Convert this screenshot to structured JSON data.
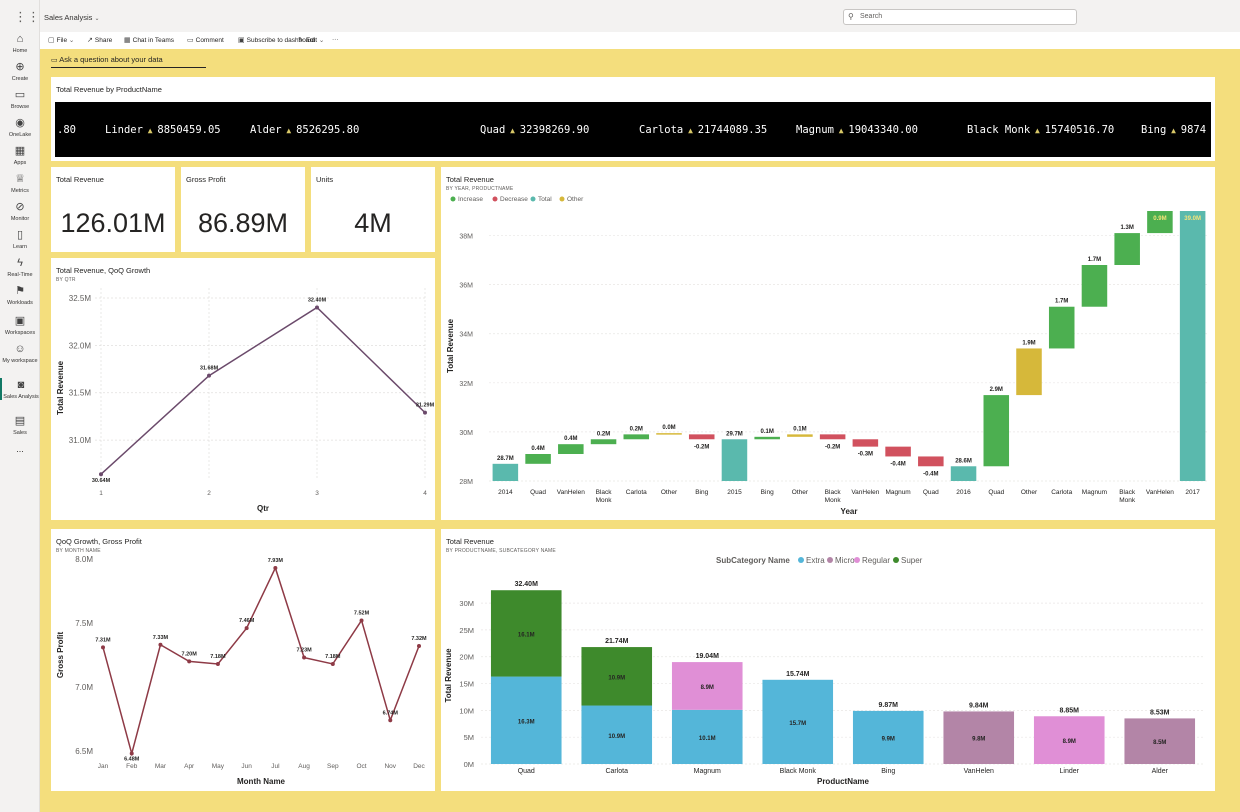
{
  "app": {
    "title": "Sales Analysis",
    "search_placeholder": "Search",
    "qna": "Ask a question about your data"
  },
  "nav": [
    {
      "label": "Home",
      "icon": "home-icon",
      "glyph": "⌂"
    },
    {
      "label": "Create",
      "icon": "create-icon",
      "glyph": "⊕"
    },
    {
      "label": "Browse",
      "icon": "browse-icon",
      "glyph": "▭"
    },
    {
      "label": "OneLake",
      "icon": "onelake-icon",
      "glyph": "◉"
    },
    {
      "label": "Apps",
      "icon": "apps-icon",
      "glyph": "▦"
    },
    {
      "label": "Metrics",
      "icon": "metrics-icon",
      "glyph": "♕"
    },
    {
      "label": "Monitor",
      "icon": "monitor-icon",
      "glyph": "⊘"
    },
    {
      "label": "Learn",
      "icon": "learn-icon",
      "glyph": "▯"
    },
    {
      "label": "Real-Time",
      "icon": "realtime-icon",
      "glyph": "ϟ"
    },
    {
      "label": "Workloads",
      "icon": "workloads-icon",
      "glyph": "⚑"
    },
    {
      "label": "Workspaces",
      "icon": "workspaces-icon",
      "glyph": "▣"
    },
    {
      "label": "My workspace",
      "icon": "my-workspace-icon",
      "glyph": "☺"
    },
    {
      "label": "Sales Analysis",
      "icon": "sales-analysis-icon",
      "glyph": "◙"
    },
    {
      "label": "Sales",
      "icon": "sales-icon",
      "glyph": "▤"
    },
    {
      "label": "...",
      "icon": "more-icon",
      "glyph": ""
    }
  ],
  "toolbar": [
    {
      "label": "File",
      "icon": "file-icon",
      "glyph": "▢",
      "chevron": "⌄"
    },
    {
      "label": "Share",
      "icon": "share-icon",
      "glyph": "↗",
      "chevron": ""
    },
    {
      "label": "Chat in Teams",
      "icon": "teams-icon",
      "glyph": "▦",
      "chevron": ""
    },
    {
      "label": "Comment",
      "icon": "comment-icon",
      "glyph": "▭",
      "chevron": ""
    },
    {
      "label": "Subscribe to dashboard",
      "icon": "subscribe-icon",
      "glyph": "▣",
      "chevron": ""
    },
    {
      "label": "Edit",
      "icon": "edit-icon",
      "glyph": "✎",
      "chevron": "⌄"
    },
    {
      "label": "···",
      "icon": "more-options-icon",
      "glyph": "",
      "chevron": ""
    }
  ],
  "ticker": {
    "title": "Total Revenue by ProductName",
    "items": [
      {
        "name": "",
        "value": ".80"
      },
      {
        "name": "Linder",
        "value": "8850459.05"
      },
      {
        "name": "Alder",
        "value": "8526295.80"
      },
      {
        "name": "Quad",
        "value": "32398269.90"
      },
      {
        "name": "Carlota",
        "value": "21744089.35"
      },
      {
        "name": "Magnum",
        "value": "19043340.00"
      },
      {
        "name": "Black Monk",
        "value": "15740516.70"
      },
      {
        "name": "Bing",
        "value": "9874"
      }
    ]
  },
  "kpis": [
    {
      "title": "Total Revenue",
      "value": "126.01M"
    },
    {
      "title": "Gross Profit",
      "value": "86.89M"
    },
    {
      "title": "Units",
      "value": "4M"
    }
  ],
  "colors": {
    "increase": "#4caf50",
    "decrease": "#d1515e",
    "total": "#5ab9ad",
    "other": "#d6b83a",
    "line": "#6b4a6b",
    "line2": "#8e3a46",
    "extra": "#54b6d9",
    "micro": "#b385a7",
    "regular": "#e08fd6",
    "super": "#3e8a2c"
  },
  "chart_data": [
    {
      "type": "line",
      "title": "Total Revenue, QoQ Growth",
      "subtitle": "BY QTR",
      "xlabel": "Qtr",
      "ylabel": "Total Revenue",
      "x": [
        "1",
        "2",
        "3",
        "4"
      ],
      "values": [
        30.64,
        31.68,
        32.4,
        31.29
      ],
      "labels": [
        "30.64M",
        "31.68M",
        "32.40M",
        "31.29M"
      ],
      "yticks": [
        "31.0M",
        "31.5M",
        "32.0M",
        "32.5M"
      ],
      "ytick_values": [
        31.0,
        31.5,
        32.0,
        32.5
      ],
      "ylim": [
        30.6,
        32.5
      ],
      "grid": true
    },
    {
      "type": "waterfall",
      "title": "Total Revenue",
      "subtitle": "BY YEAR, PRODUCTNAME",
      "xlabel": "Year",
      "ylabel": "Total Revenue",
      "legend": [
        {
          "name": "Increase",
          "color": "#4caf50"
        },
        {
          "name": "Decrease",
          "color": "#d1515e"
        },
        {
          "name": "Total",
          "color": "#5ab9ad"
        },
        {
          "name": "Other",
          "color": "#d6b83a"
        }
      ],
      "yticks": [
        "28M",
        "30M",
        "32M",
        "34M",
        "36M",
        "38M"
      ],
      "ytick_values": [
        28,
        30,
        32,
        34,
        36,
        38
      ],
      "ylim": [
        28,
        39
      ],
      "bars": [
        {
          "cat": "2014",
          "kind": "total",
          "start": 28,
          "end": 28.7,
          "label": "28.7M"
        },
        {
          "cat": "Quad",
          "kind": "increase",
          "start": 28.7,
          "end": 29.1,
          "label": "0.4M"
        },
        {
          "cat": "VanHelen",
          "kind": "increase",
          "start": 29.1,
          "end": 29.5,
          "label": "0.4M"
        },
        {
          "cat": "Black Monk",
          "kind": "increase",
          "start": 29.5,
          "end": 29.7,
          "label": "0.2M"
        },
        {
          "cat": "Carlota",
          "kind": "increase",
          "start": 29.7,
          "end": 29.9,
          "label": "0.2M"
        },
        {
          "cat": "Other",
          "kind": "other",
          "start": 29.9,
          "end": 29.95,
          "label": "0.0M"
        },
        {
          "cat": "Bing",
          "kind": "decrease",
          "start": 29.9,
          "end": 29.7,
          "label": "-0.2M"
        },
        {
          "cat": "2015",
          "kind": "total",
          "start": 28,
          "end": 29.7,
          "label": "29.7M"
        },
        {
          "cat": "Bing",
          "kind": "increase",
          "start": 29.7,
          "end": 29.8,
          "label": "0.1M"
        },
        {
          "cat": "Other",
          "kind": "other",
          "start": 29.8,
          "end": 29.9,
          "label": "0.1M"
        },
        {
          "cat": "Black Monk",
          "kind": "decrease",
          "start": 29.9,
          "end": 29.7,
          "label": "-0.2M"
        },
        {
          "cat": "VanHelen",
          "kind": "decrease",
          "start": 29.7,
          "end": 29.4,
          "label": "-0.3M"
        },
        {
          "cat": "Magnum",
          "kind": "decrease",
          "start": 29.4,
          "end": 29.0,
          "label": "-0.4M"
        },
        {
          "cat": "Quad",
          "kind": "decrease",
          "start": 29.0,
          "end": 28.6,
          "label": "-0.4M"
        },
        {
          "cat": "2016",
          "kind": "total",
          "start": 28,
          "end": 28.6,
          "label": "28.6M"
        },
        {
          "cat": "Quad",
          "kind": "increase",
          "start": 28.6,
          "end": 31.5,
          "label": "2.9M"
        },
        {
          "cat": "Other",
          "kind": "other",
          "start": 31.5,
          "end": 33.4,
          "label": "1.9M"
        },
        {
          "cat": "Carlota",
          "kind": "increase",
          "start": 33.4,
          "end": 35.1,
          "label": "1.7M"
        },
        {
          "cat": "Magnum",
          "kind": "increase",
          "start": 35.1,
          "end": 36.8,
          "label": "1.7M"
        },
        {
          "cat": "Black Monk",
          "kind": "increase",
          "start": 36.8,
          "end": 38.1,
          "label": "1.3M"
        },
        {
          "cat": "VanHelen",
          "kind": "increase",
          "start": 38.1,
          "end": 39.0,
          "label": "0.9M"
        },
        {
          "cat": "2017",
          "kind": "total",
          "start": 28,
          "end": 39.0,
          "label": "39.0M"
        }
      ]
    },
    {
      "type": "line",
      "title": "QoQ Growth, Gross Profit",
      "subtitle": "BY MONTH NAME",
      "xlabel": "Month Name",
      "ylabel": "Gross Profit",
      "x": [
        "Jan",
        "Feb",
        "Mar",
        "Apr",
        "May",
        "Jun",
        "Jul",
        "Aug",
        "Sep",
        "Oct",
        "Nov",
        "Dec"
      ],
      "values": [
        7.31,
        6.48,
        7.33,
        7.2,
        7.18,
        7.46,
        7.93,
        7.23,
        7.18,
        7.52,
        6.74,
        7.32
      ],
      "labels": [
        "7.31M",
        "6.48M",
        "7.33M",
        "7.20M",
        "7.18M",
        "7.46M",
        "7.93M",
        "7.23M",
        "7.18M",
        "7.52M",
        "6.74M",
        "7.32M"
      ],
      "yticks": [
        "6.5M",
        "7.0M",
        "7.5M",
        "8.0M"
      ],
      "ytick_values": [
        6.5,
        7.0,
        7.5,
        8.0
      ],
      "ylim": [
        6.5,
        8.0
      ],
      "grid": false
    },
    {
      "type": "bar",
      "stacked": true,
      "title": "Total Revenue",
      "subtitle": "BY PRODUCTNAME, SUBCATEGORY NAME",
      "xlabel": "ProductName",
      "ylabel": "Total Revenue",
      "legend_title": "SubCategory Name",
      "legend": [
        {
          "name": "Extra",
          "color": "#54b6d9"
        },
        {
          "name": "Micro",
          "color": "#b385a7"
        },
        {
          "name": "Regular",
          "color": "#e08fd6"
        },
        {
          "name": "Super",
          "color": "#3e8a2c"
        }
      ],
      "yticks": [
        "0M",
        "5M",
        "10M",
        "15M",
        "20M",
        "25M",
        "30M"
      ],
      "ytick_values": [
        0,
        5,
        10,
        15,
        20,
        25,
        30
      ],
      "ylim": [
        0,
        33
      ],
      "categories": [
        "Quad",
        "Carlota",
        "Magnum",
        "Black Monk",
        "Bing",
        "VanHelen",
        "Linder",
        "Alder"
      ],
      "totals": [
        "32.40M",
        "21.74M",
        "19.04M",
        "15.74M",
        "9.87M",
        "9.84M",
        "8.85M",
        "8.53M"
      ],
      "stacks": [
        [
          {
            "sub": "Extra",
            "value": 16.3,
            "label": "16.3M"
          },
          {
            "sub": "Super",
            "value": 16.1,
            "label": "16.1M"
          }
        ],
        [
          {
            "sub": "Extra",
            "value": 10.9,
            "label": "10.9M"
          },
          {
            "sub": "Super",
            "value": 10.9,
            "label": "10.9M"
          }
        ],
        [
          {
            "sub": "Extra",
            "value": 10.1,
            "label": "10.1M"
          },
          {
            "sub": "Regular",
            "value": 8.9,
            "label": "8.9M"
          }
        ],
        [
          {
            "sub": "Extra",
            "value": 15.7,
            "label": "15.7M"
          }
        ],
        [
          {
            "sub": "Extra",
            "value": 9.9,
            "label": "9.9M"
          }
        ],
        [
          {
            "sub": "Micro",
            "value": 9.8,
            "label": "9.8M"
          }
        ],
        [
          {
            "sub": "Regular",
            "value": 8.9,
            "label": "8.9M"
          }
        ],
        [
          {
            "sub": "Micro",
            "value": 8.5,
            "label": "8.5M"
          }
        ]
      ]
    }
  ]
}
